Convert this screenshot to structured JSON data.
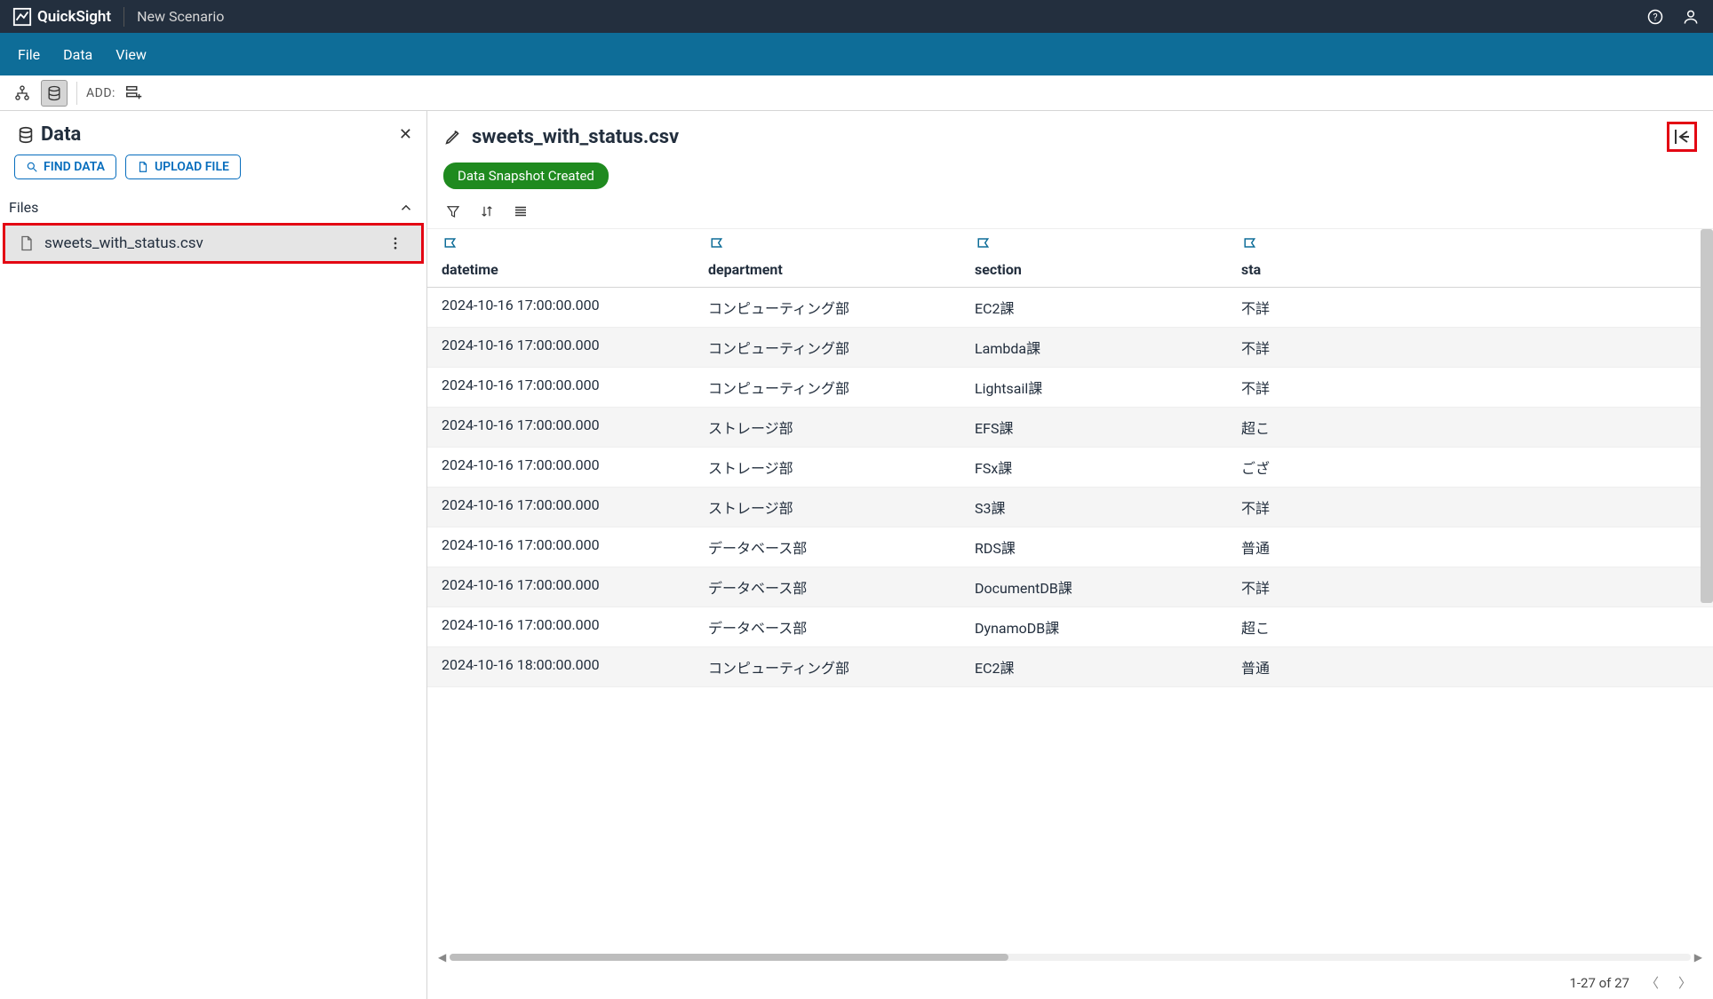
{
  "header": {
    "app_name": "QuickSight",
    "scenario": "New Scenario"
  },
  "menubar": [
    "File",
    "Data",
    "View"
  ],
  "toolbar": {
    "add_label": "ADD:"
  },
  "left": {
    "title": "Data",
    "find_label": "FIND DATA",
    "upload_label": "UPLOAD FILE",
    "files_label": "Files",
    "file_name": "sweets_with_status.csv"
  },
  "right": {
    "title": "sweets_with_status.csv",
    "badge": "Data Snapshot Created",
    "columns": [
      "datetime",
      "department",
      "section",
      "sta"
    ],
    "rows": [
      {
        "datetime": "2024-10-16 17:00:00.000",
        "department": "コンピューティング部",
        "section": "EC2課",
        "status": "不詳"
      },
      {
        "datetime": "2024-10-16 17:00:00.000",
        "department": "コンピューティング部",
        "section": "Lambda課",
        "status": "不詳"
      },
      {
        "datetime": "2024-10-16 17:00:00.000",
        "department": "コンピューティング部",
        "section": "Lightsail課",
        "status": "不詳"
      },
      {
        "datetime": "2024-10-16 17:00:00.000",
        "department": "ストレージ部",
        "section": "EFS課",
        "status": "超こ"
      },
      {
        "datetime": "2024-10-16 17:00:00.000",
        "department": "ストレージ部",
        "section": "FSx課",
        "status": "ござ"
      },
      {
        "datetime": "2024-10-16 17:00:00.000",
        "department": "ストレージ部",
        "section": "S3課",
        "status": "不詳"
      },
      {
        "datetime": "2024-10-16 17:00:00.000",
        "department": "データベース部",
        "section": "RDS課",
        "status": "普通"
      },
      {
        "datetime": "2024-10-16 17:00:00.000",
        "department": "データベース部",
        "section": "DocumentDB課",
        "status": "不詳"
      },
      {
        "datetime": "2024-10-16 17:00:00.000",
        "department": "データベース部",
        "section": "DynamoDB課",
        "status": "超こ"
      },
      {
        "datetime": "2024-10-16 18:00:00.000",
        "department": "コンピューティング部",
        "section": "EC2課",
        "status": "普通"
      }
    ],
    "footer": "1-27 of 27"
  }
}
